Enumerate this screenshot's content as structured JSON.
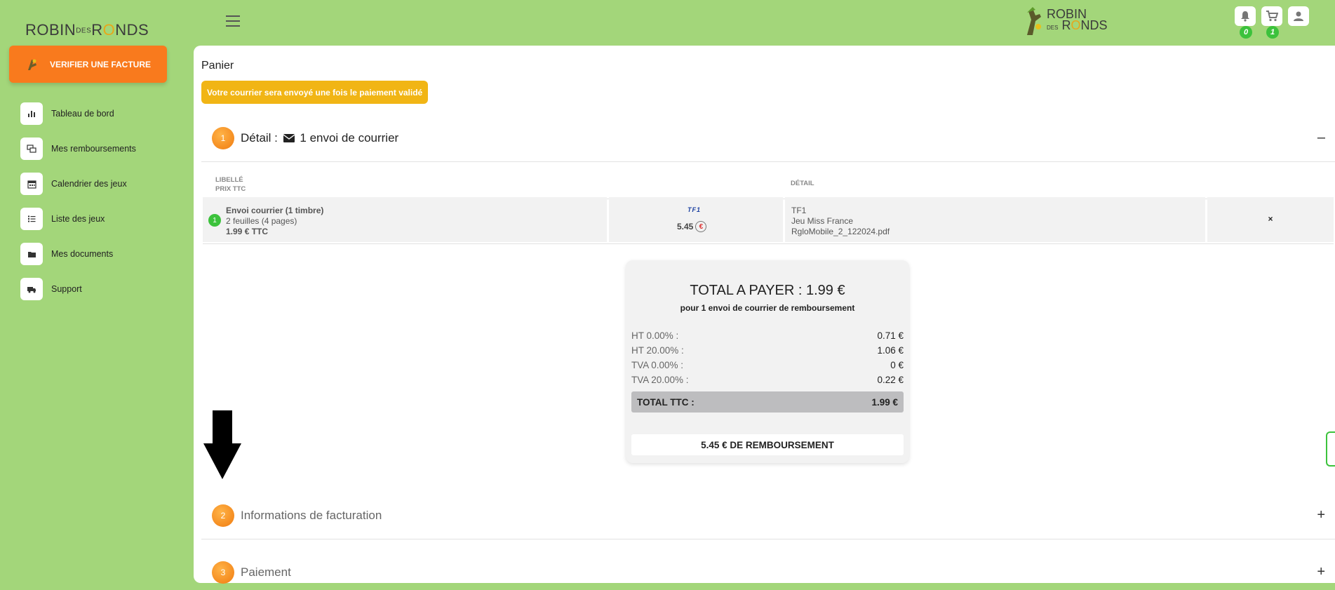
{
  "sidebar": {
    "logo": {
      "left": "ROBIN",
      "des": "DES",
      "r": "R",
      "o": "O",
      "right": "NDS"
    },
    "verify_button": "VERIFIER UNE FACTURE",
    "items": [
      {
        "label": "Tableau de bord",
        "icon": "bar-chart-icon"
      },
      {
        "label": "Mes remboursements",
        "icon": "refund-icon"
      },
      {
        "label": "Calendrier des jeux",
        "icon": "calendar-icon"
      },
      {
        "label": "Liste des jeux",
        "icon": "list-icon"
      },
      {
        "label": "Mes documents",
        "icon": "folder-icon"
      },
      {
        "label": "Support",
        "icon": "truck-icon"
      }
    ]
  },
  "header": {
    "brand": {
      "top": "ROBIN",
      "des": "DES",
      "r": "R",
      "o": "O",
      "right": "NDS"
    },
    "notifications_count": "0",
    "cart_count": "1"
  },
  "main": {
    "title": "Panier",
    "alert": "Votre courrier sera envoyé une fois le paiement validé",
    "step1": {
      "num": "1",
      "label": "Détail :",
      "suffix": "1 envoi de courrier",
      "toggle": "–"
    },
    "table": {
      "head_libelle": "LIBELLÉ",
      "head_prix": "PRIX TTC",
      "head_detail": "DÉTAIL",
      "rows": [
        {
          "num": "1",
          "title": "Envoi courrier (1 timbre)",
          "pages": "2 feuilles (4 pages)",
          "price": "1.99 € TTC",
          "channel_logo": "TF1",
          "refund": "5.45",
          "detail_1": "TF1",
          "detail_2": "Jeu Miss France",
          "detail_3": "RgloMobile_2_122024.pdf",
          "delete": "×"
        }
      ]
    },
    "total": {
      "title": "TOTAL A PAYER : 1.99 €",
      "subtitle": "pour 1 envoi de courrier de remboursement",
      "lines": [
        {
          "label": "HT 0.00% :",
          "value": "0.71 €"
        },
        {
          "label": "HT 20.00% :",
          "value": "1.06 €"
        },
        {
          "label": "TVA 0.00% :",
          "value": "0 €"
        },
        {
          "label": "TVA 20.00% :",
          "value": "0.22 €"
        }
      ],
      "ttc_label": "TOTAL TTC :",
      "ttc_value": "1.99 €",
      "refund": "5.45 € DE REMBOURSEMENT"
    },
    "step2": {
      "num": "2",
      "label": "Informations de facturation",
      "toggle": "+"
    },
    "step3": {
      "num": "3",
      "label": "Paiement",
      "toggle": "+"
    }
  },
  "colors": {
    "background": "#a3d67a",
    "accent": "#f97a1d",
    "alert": "#f1b515",
    "badge": "#3cc23c"
  }
}
